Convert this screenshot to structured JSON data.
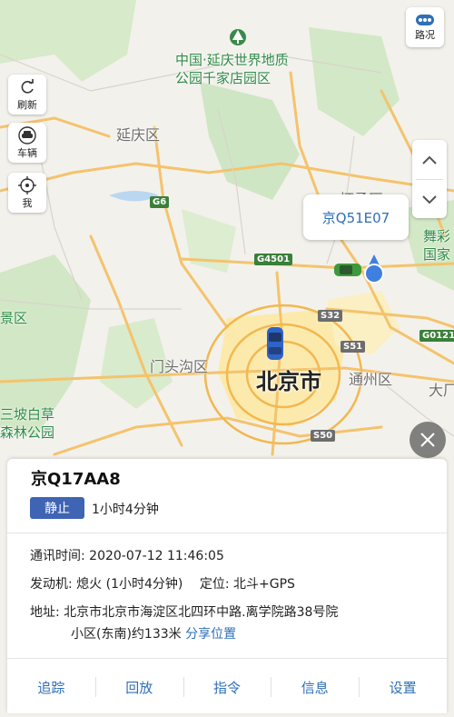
{
  "map": {
    "labels": {
      "yanqing_park_line1": "中国·延庆世界地质",
      "yanqing_park_line2": "公园千家店园区",
      "yanqing": "延庆区",
      "huairou": "怀柔区",
      "wu_cai_1": "舞彩",
      "wu_cai_2": "国家",
      "jingxi": "景区",
      "mentougou": "门头沟区",
      "beijing": "北京市",
      "tongzhou": "通州区",
      "sanpo_1": "三坡白草",
      "sanpo_2": "森林公园",
      "daxing": "大厂"
    },
    "shields": {
      "g6": "G6",
      "g4501": "G4501",
      "s32": "S32",
      "s51": "S51",
      "g0121": "G0121",
      "s50": "S50"
    }
  },
  "controls": {
    "traffic_label": "路况",
    "refresh_label": "刷新",
    "vehicle_label": "车辆",
    "me_label": "我"
  },
  "bubble": {
    "plate": "京Q51E07"
  },
  "vehicle": {
    "plate": "京Q17AA8",
    "status": "静止",
    "status_duration": "1小时4分钟",
    "comm_time_label": "通讯时间:",
    "comm_time": "2020-07-12 11:46:05",
    "engine_label": "发动机:",
    "engine_value": "熄火 (1小时4分钟)",
    "location_label": "定位:",
    "location_value": "北斗+GPS",
    "address_label": "地址:",
    "address_line1": "北京市北京市海淀区北四环中路.离学院路38号院",
    "address_line2": "小区(东南)约133米",
    "share_label": "分享位置"
  },
  "actions": {
    "track": "追踪",
    "playback": "回放",
    "command": "指令",
    "info": "信息",
    "settings": "设置"
  },
  "colors": {
    "accent": "#3f64b4",
    "link": "#2f6fb6",
    "city_zone": "#fde9a6",
    "forest": "#cfe6c4",
    "highway": "#f6c164"
  }
}
